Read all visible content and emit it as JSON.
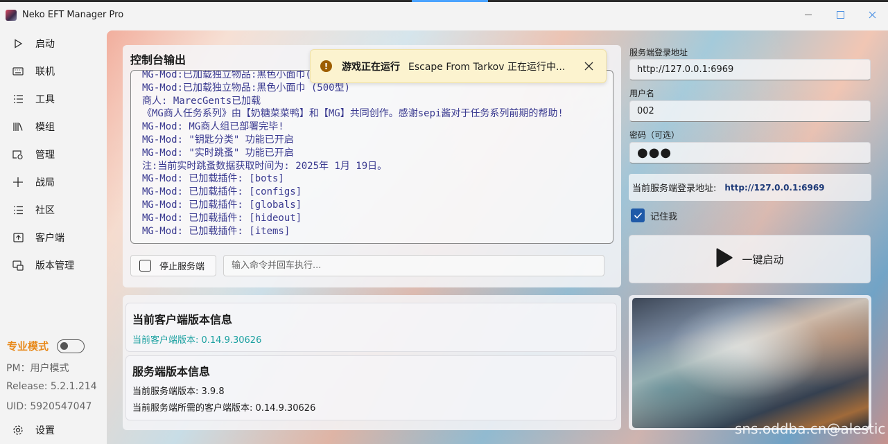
{
  "window": {
    "title": "Neko EFT Manager Pro"
  },
  "sidebar": {
    "items": [
      {
        "label": "启动",
        "icon": "play-icon"
      },
      {
        "label": "联机",
        "icon": "keyboard-icon"
      },
      {
        "label": "工具",
        "icon": "checklist-icon"
      },
      {
        "label": "模组",
        "icon": "library-icon"
      },
      {
        "label": "管理",
        "icon": "settings-doc-icon"
      },
      {
        "label": "战局",
        "icon": "plus-icon"
      },
      {
        "label": "社区",
        "icon": "list-icon"
      },
      {
        "label": "客户端",
        "icon": "client-icon"
      },
      {
        "label": "版本管理",
        "icon": "version-icon"
      }
    ],
    "pro_mode_label": "专业模式",
    "pm": "PM：用户模式",
    "release": "Release: 5.2.1.214",
    "uid": "UID: 5920547047",
    "settings_label": "设置"
  },
  "console": {
    "title": "控制台输出",
    "lines": [
      "MG-Mod:已加载独立物品:黑色小面巾(500型)",
      "MG-Mod:已加载独立物品:黑色小面巾 (500型)",
      "商人: MarecGents已加载",
      "《MG商人任务系列》由【奶糖菜菜鸭】和【MG】共同创作。感谢sepi酱对于任务系列前期的帮助!",
      "MG-Mod: MG商人组已部署完毕!",
      "MG-Mod: \"钥匙分类\" 功能已开启",
      "MG-Mod: \"实时跳蚤\" 功能已开启",
      "注:当前实时跳蚤数据获取时间为: 2025年 1月 19日。",
      "MG-Mod: 已加载插件: [bots]",
      "MG-Mod: 已加载插件: [configs]",
      "MG-Mod: 已加载插件: [globals]",
      "MG-Mod: 已加载插件: [hideout]",
      "MG-Mod: 已加载插件: [items]"
    ],
    "stop_label": "停止服务端",
    "command_placeholder": "输入命令并回车执行..."
  },
  "toast": {
    "title": "游戏正在运行",
    "message": "Escape From Tarkov 正在运行中..."
  },
  "login": {
    "server_label": "服务端登录地址",
    "server_value": "http://127.0.0.1:6969",
    "user_label": "用户名",
    "user_value": "002",
    "password_label": "密码（可选）",
    "password_value": "●●●",
    "current_label": "当前服务端登录地址:",
    "current_value": "http://127.0.0.1:6969",
    "remember_label": "记住我",
    "launch_label": "一键启动"
  },
  "version": {
    "client_title": "当前客户端版本信息",
    "client_line": "当前客户端版本: 0.14.9.30626",
    "server_title": "服务端版本信息",
    "server_line": "当前服务端版本: 3.9.8",
    "server_required": "当前服务端所需的客户端版本: 0.14.9.30626"
  },
  "watermark": "sns.oddba.cn@alestic",
  "colors": {
    "accent": "#1f5aa8",
    "pro_mode": "#e8891a",
    "toast_bg": "#fcf3cf",
    "console_text": "#3a3a90",
    "client_version": "#1aa0a0"
  }
}
